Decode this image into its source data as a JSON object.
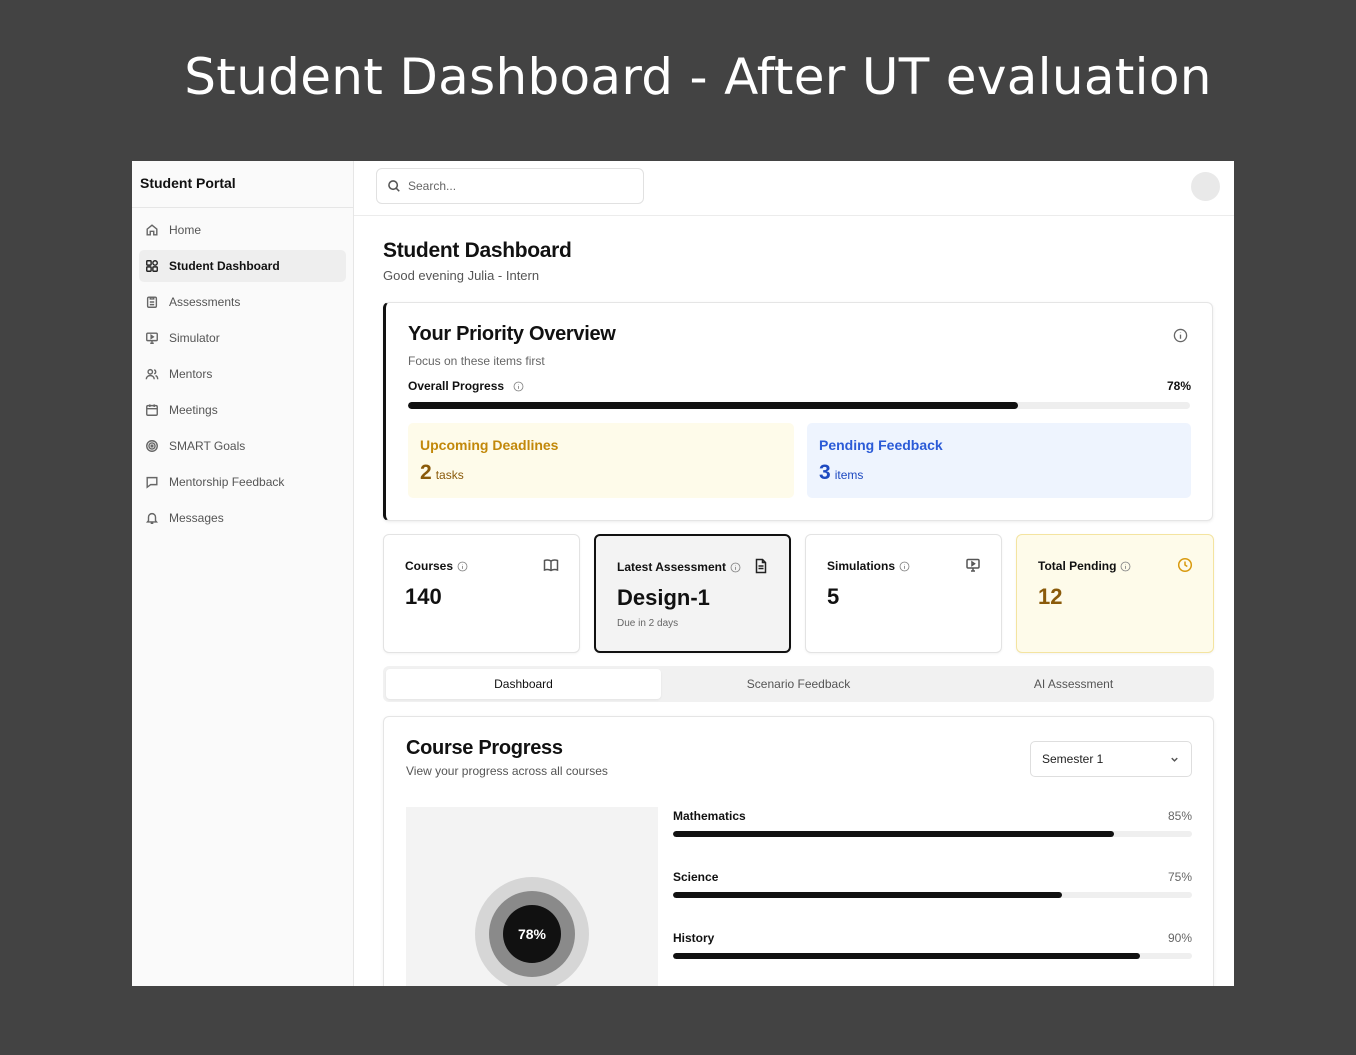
{
  "headline": "Student Dashboard - After UT evaluation",
  "sidebar": {
    "brand": "Student Portal",
    "items": [
      {
        "label": "Home",
        "icon": "home-icon",
        "active": false
      },
      {
        "label": "Student Dashboard",
        "icon": "dashboard-icon",
        "active": true
      },
      {
        "label": "Assessments",
        "icon": "clipboard-icon",
        "active": false
      },
      {
        "label": "Simulator",
        "icon": "monitor-icon",
        "active": false
      },
      {
        "label": "Mentors",
        "icon": "users-icon",
        "active": false
      },
      {
        "label": "Meetings",
        "icon": "calendar-icon",
        "active": false
      },
      {
        "label": "SMART Goals",
        "icon": "target-icon",
        "active": false
      },
      {
        "label": "Mentorship Feedback",
        "icon": "chat-icon",
        "active": false
      },
      {
        "label": "Messages",
        "icon": "bell-icon",
        "active": false
      }
    ]
  },
  "topbar": {
    "search_placeholder": "Search..."
  },
  "page": {
    "title": "Student Dashboard",
    "subtitle": "Good evening Julia - Intern"
  },
  "priority": {
    "title": "Your Priority Overview",
    "subtitle": "Focus on these items first",
    "progress_label": "Overall Progress",
    "progress_text": "78%",
    "progress_value": 78,
    "deadlines": {
      "title": "Upcoming Deadlines",
      "value": "2",
      "unit": "tasks"
    },
    "feedback": {
      "title": "Pending Feedback",
      "value": "3",
      "unit": "items"
    }
  },
  "stats": {
    "courses": {
      "label": "Courses",
      "value": "140",
      "icon": "book-icon"
    },
    "assessment": {
      "label": "Latest Assessment",
      "value": "Design-1",
      "detail": "Due in 2 days",
      "icon": "document-icon"
    },
    "simulations": {
      "label": "Simulations",
      "value": "5",
      "icon": "monitor-icon"
    },
    "pending": {
      "label": "Total Pending",
      "value": "12",
      "icon": "clock-icon"
    }
  },
  "tabs": [
    {
      "label": "Dashboard",
      "active": true
    },
    {
      "label": "Scenario Feedback",
      "active": false
    },
    {
      "label": "AI Assessment",
      "active": false
    }
  ],
  "course_progress": {
    "title": "Course Progress",
    "subtitle": "View your progress across all courses",
    "semester": "Semester 1",
    "overall_text": "78%",
    "overall_value": 78,
    "courses": [
      {
        "name": "Mathematics",
        "text": "85%",
        "value": 85
      },
      {
        "name": "Science",
        "text": "75%",
        "value": 75
      },
      {
        "name": "History",
        "text": "90%",
        "value": 90
      }
    ]
  },
  "colors": {
    "accent": "#111111",
    "deadline_bg": "#fefbea",
    "feedback_bg": "#eef4fe",
    "deadline_text": "#c2880a",
    "feedback_text": "#2b5bd7"
  }
}
